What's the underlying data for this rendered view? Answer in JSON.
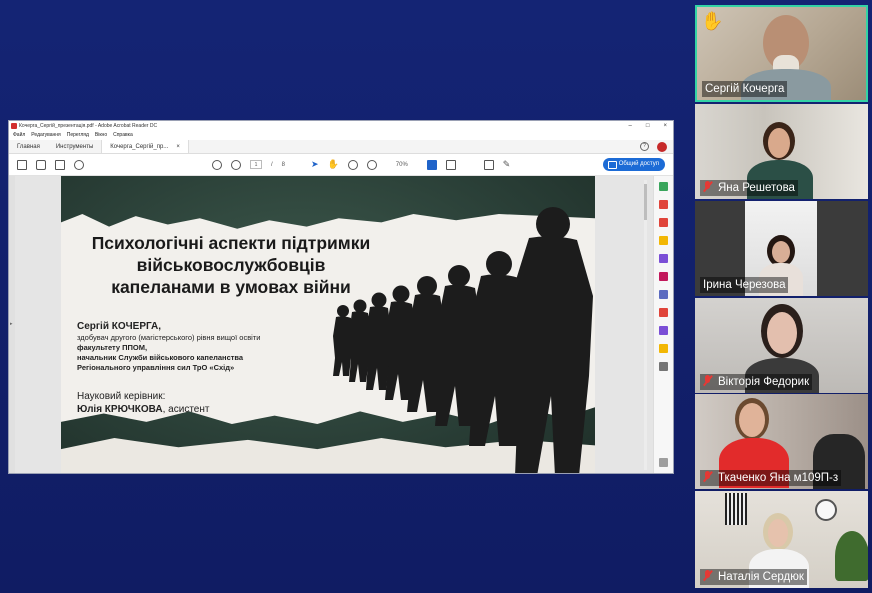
{
  "acrobat": {
    "window_title": "Кочерга_Сергій_презентація.pdf - Adobe Acrobat Reader DC",
    "window_controls": [
      "–",
      "□",
      "×"
    ],
    "menu": [
      "Файл",
      "Редагування",
      "Перегляд",
      "Вікно",
      "Справка"
    ],
    "tabs": {
      "home": "Главная",
      "tools": "Инструменты",
      "document": "Кочерга_Сергій_пр..."
    },
    "toolbar": {
      "page_current": "1",
      "page_sep": "/",
      "page_total": "8",
      "zoom": "70%",
      "share_button": "Общий доступ"
    }
  },
  "slide": {
    "title_lines": [
      "Психологічні аспекти підтримки",
      "військовослужбовців",
      "капеланами в умовах війни"
    ],
    "author_name": "Сергій КОЧЕРГА,",
    "author_lines": [
      "здобувач другого (магістерського) рівня вищої освіти",
      "факультету ППОМ,",
      "начальник Служби військового капеланства",
      "Регіонального управління сил ТрО «Схід»"
    ],
    "advisor_label": "Науковий керівник:",
    "advisor_name": "Юлія КРЮЧКОВА",
    "advisor_role": ",  асистент"
  },
  "participants": [
    {
      "name": "Сергій Кочерга",
      "hand_raised": true,
      "muted": false
    },
    {
      "name": "Яна Решетова",
      "muted": true
    },
    {
      "name": "Ірина Черезова",
      "muted": false
    },
    {
      "name": "Вікторія Федорик",
      "muted": true
    },
    {
      "name": "Ткаченко Яна м109П-з",
      "muted": true
    },
    {
      "name": "Наталія Сердюк",
      "muted": true
    }
  ],
  "colors": {
    "background": "#13206e",
    "active_speaker": "#33d3a5",
    "muted": "#e53935",
    "share": "#1c6bd6"
  }
}
